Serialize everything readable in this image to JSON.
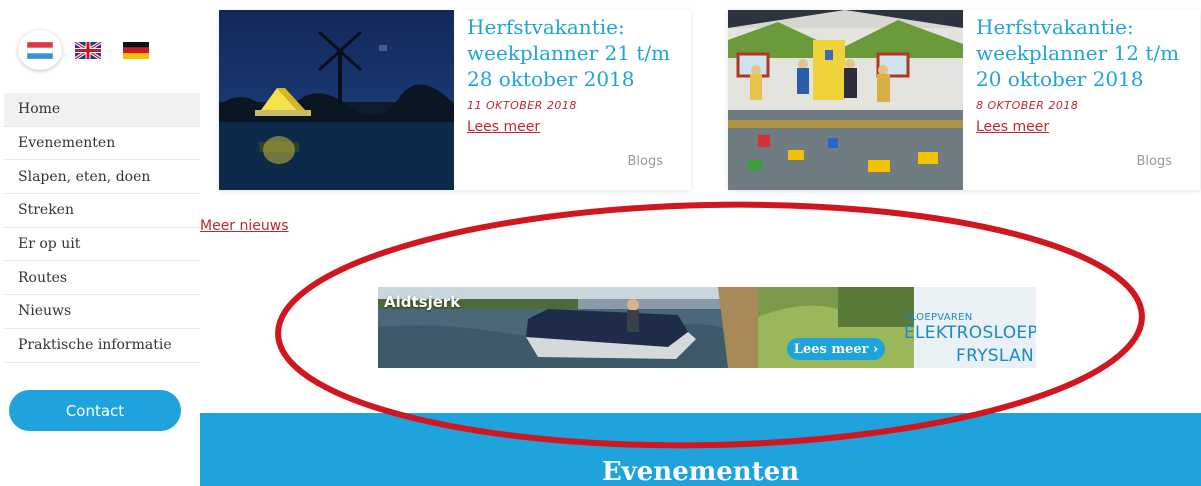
{
  "sidebar": {
    "languages": [
      {
        "name": "Nederlands",
        "icon": "flag-nl-icon",
        "active": true
      },
      {
        "name": "English",
        "icon": "flag-uk-icon",
        "active": false
      },
      {
        "name": "Deutsch",
        "icon": "flag-de-icon",
        "active": false
      }
    ],
    "nav_items": [
      "Home",
      "Evenementen",
      "Slapen, eten, doen",
      "Streken",
      "Er op uit",
      "Routes",
      "Nieuws",
      "Praktische informatie"
    ],
    "active_item": "Home",
    "contact_label": "Contact"
  },
  "cards": [
    {
      "title": "Herfstvakantie: weekplanner 21 t/m 28 oktober 2018",
      "date": "11 OKTOBER 2018",
      "more": "Lees meer",
      "category": "Blogs",
      "image": "night-windmill-tent-photo"
    },
    {
      "title": "Herfstvakantie: weekplanner 12 t/m 20 oktober 2018",
      "date": "8 OKTOBER 2018",
      "more": "Lees meer",
      "category": "Blogs",
      "image": "children-playhall-photo"
    }
  ],
  "meer_nieuws": "Meer nieuws",
  "banner": {
    "place": "Aldtsjerk",
    "button": "Lees meer ›",
    "brand_small": "SLOEPVAREN",
    "brand_line1": "ELEKTROSLOEP",
    "brand_line2": "FRYSLAN"
  },
  "events_section": {
    "title": "Evenementen"
  },
  "colors": {
    "accent_blue": "#1ea3dd",
    "link_red": "#c0262c",
    "annotation_red": "#d0161f"
  }
}
